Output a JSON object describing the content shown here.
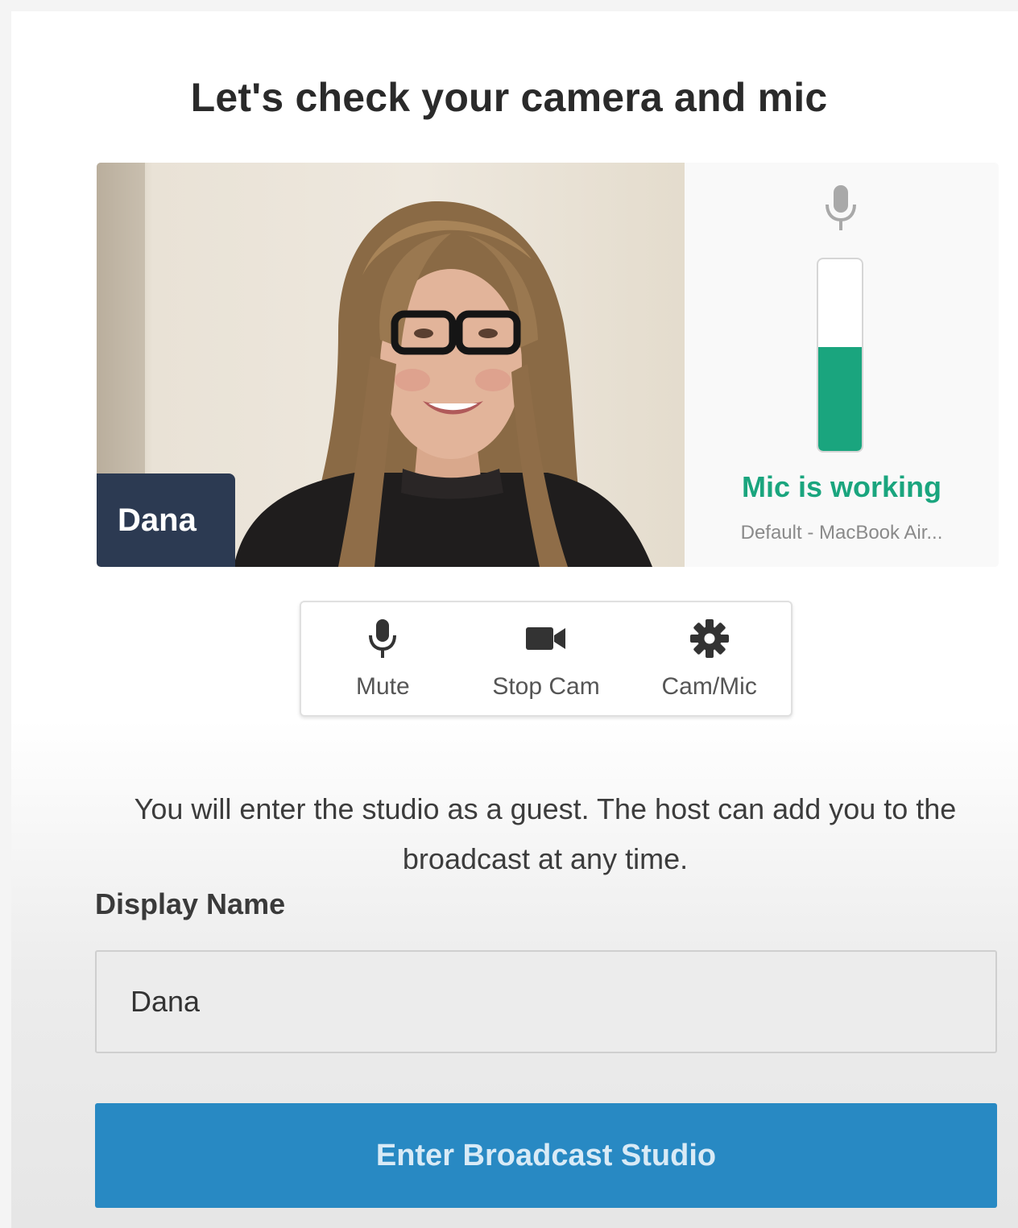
{
  "page": {
    "title": "Let's check your camera and mic"
  },
  "video": {
    "participant_name": "Dana"
  },
  "mic": {
    "icon": "microphone-icon",
    "level": 0.54,
    "status": "Mic is working",
    "device": "Default - MacBook Air...",
    "color": "#1aa57e"
  },
  "controls": {
    "mute": {
      "label": "Mute",
      "icon": "microphone-icon"
    },
    "stop_cam": {
      "label": "Stop Cam",
      "icon": "video-camera-icon"
    },
    "cam_mic": {
      "label": "Cam/Mic",
      "icon": "gear-icon"
    }
  },
  "info_text": "You will enter the studio as a guest. The host can add you to the broadcast at any time.",
  "display_name": {
    "label": "Display Name",
    "value": "Dana"
  },
  "enter_button": {
    "label": "Enter Broadcast Studio",
    "color": "#2889c3"
  }
}
